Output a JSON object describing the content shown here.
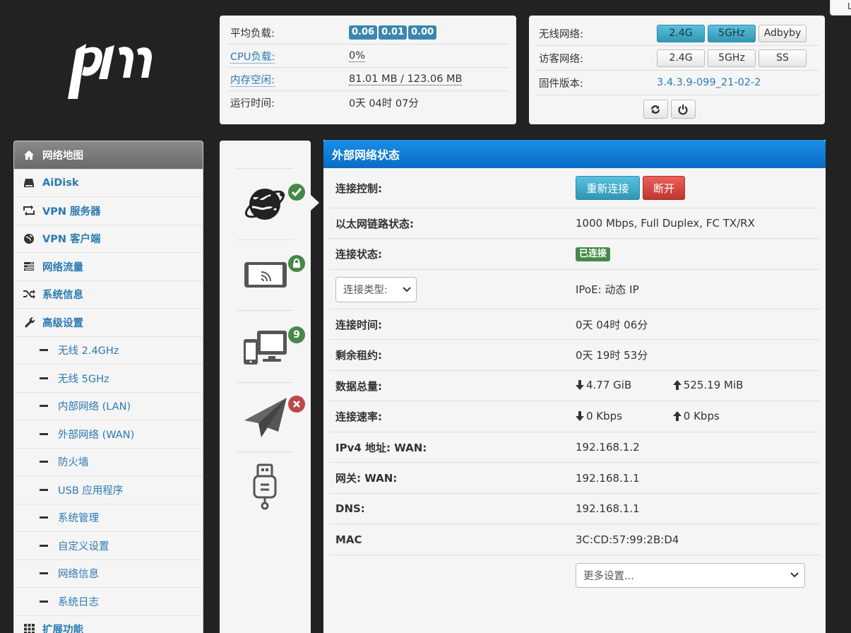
{
  "corner": {
    "label": "L"
  },
  "sysinfo": {
    "load_label": "平均负载:",
    "load_values": [
      "0.06",
      "0.01",
      "0.00"
    ],
    "cpu_label": "CPU负载:",
    "cpu_value": "0%",
    "mem_label": "内存空闲:",
    "mem_value": "81.01 MB / 123.06 MB",
    "uptime_label": "运行时间:",
    "uptime_value": "0天 04时 07分"
  },
  "wireless": {
    "wl_label": "无线网络:",
    "wl_buttons": [
      "2.4G",
      "5GHz",
      "Adbyby"
    ],
    "guest_label": "访客网络:",
    "guest_buttons": [
      "2.4G",
      "5GHz",
      "SS"
    ],
    "fw_label": "固件版本:",
    "fw_value": "3.4.3.9-099_21-02-2"
  },
  "sidebar": {
    "items": [
      {
        "label": "网络地图",
        "icon": "home-icon"
      },
      {
        "label": "AiDisk",
        "icon": "disk-icon"
      },
      {
        "label": "VPN 服务器",
        "icon": "retweet-icon"
      },
      {
        "label": "VPN 客户端",
        "icon": "globe-icon"
      },
      {
        "label": "网络流量",
        "icon": "tasks-icon"
      },
      {
        "label": "系统信息",
        "icon": "random-icon"
      },
      {
        "label": "高级设置",
        "icon": "wrench-icon"
      }
    ],
    "subitems": [
      "无线 2.4GHz",
      "无线 5GHz",
      "内部网络 (LAN)",
      "外部网络 (WAN)",
      "防火墙",
      "USB 应用程序",
      "系统管理",
      "自定义设置",
      "网络信息",
      "系统日志"
    ],
    "ext_label": "扩展功能"
  },
  "status_icons": {
    "clients_count": "9"
  },
  "main": {
    "title": "外部网络状态",
    "ctrl_label": "连接控制:",
    "reconnect_label": "重新连接",
    "disconnect_label": "断开",
    "eth_label": "以太网链路状态:",
    "eth_value": "1000 Mbps, Full Duplex, FC TX/RX",
    "conn_label": "连接状态:",
    "conn_value": "已连接",
    "type_select": "连接类型:",
    "type_value": "IPoE: 动态 IP",
    "time_label": "连接时间:",
    "time_value": "0天 04时 06分",
    "lease_label": "剩余租约:",
    "lease_value": "0天 19时 53分",
    "total_label": "数据总量:",
    "total_down": "4.77 GiB",
    "total_up": "525.19 MiB",
    "rate_label": "连接速率:",
    "rate_down": "0 Kbps",
    "rate_up": "0 Kbps",
    "ipv4_label": "IPv4 地址: WAN:",
    "ipv4_value": "192.168.1.2",
    "gw_label": "网关: WAN:",
    "gw_value": "192.168.1.1",
    "dns_label": "DNS:",
    "dns_value": "192.168.1.1",
    "mac_label": "MAC",
    "mac_value": "3C:CD:57:99:2B:D4",
    "more_select": "更多设置..."
  }
}
